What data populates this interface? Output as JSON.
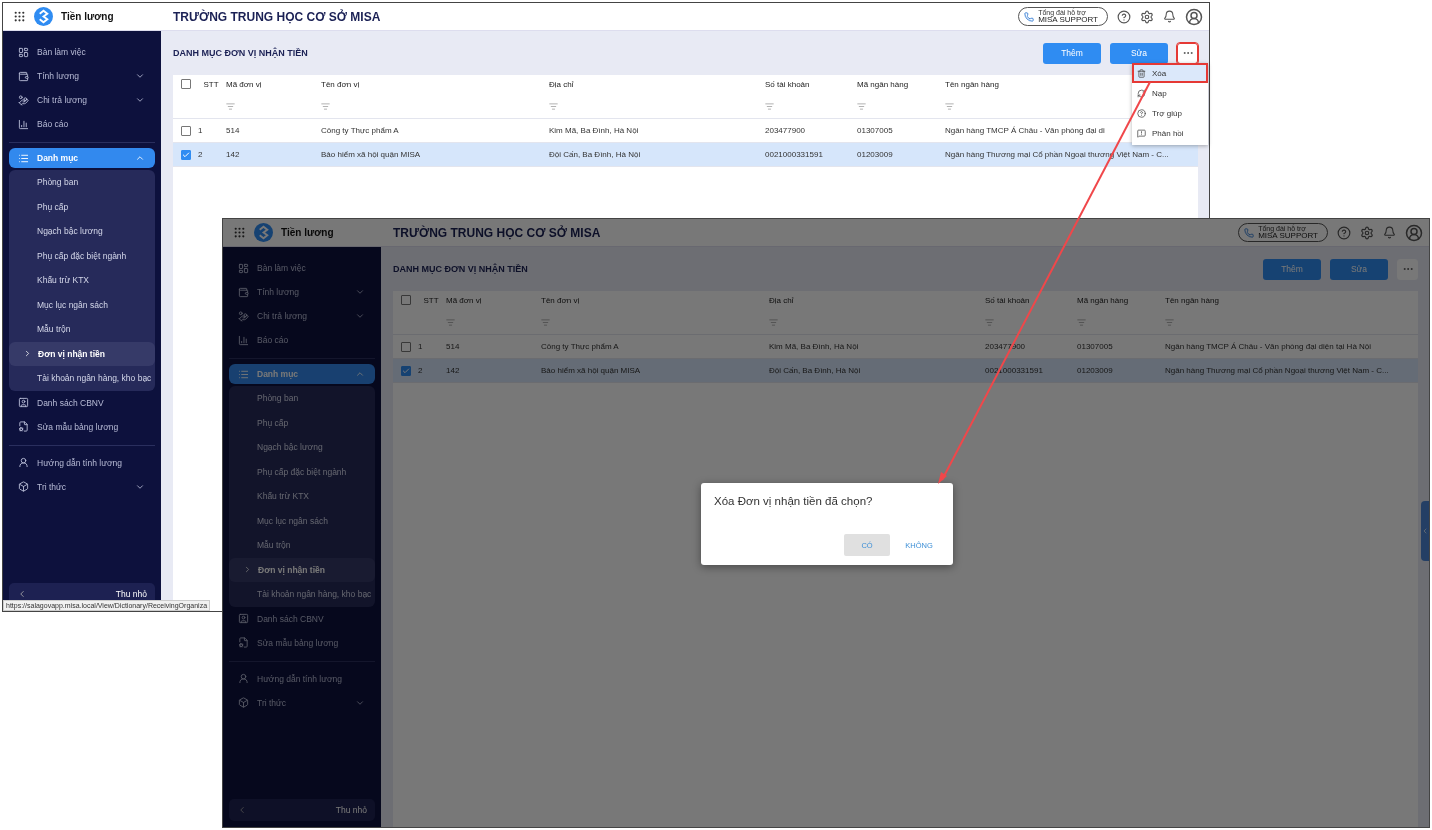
{
  "windows": [
    {
      "app_name": "Tiền lương",
      "school": "TRƯỜNG TRUNG HỌC CƠ SỞ MISA",
      "support": {
        "caption": "Tổng đài hỗ trợ",
        "label": "MISA SUPPORT"
      },
      "sidebar": {
        "groups": [
          [
            {
              "label": "Bàn làm việc",
              "selected": false
            },
            {
              "label": "Tính lương",
              "selected": false,
              "expanded": false
            },
            {
              "label": "Chi trả lương",
              "selected": false,
              "expanded": false
            },
            {
              "label": "Báo cáo",
              "selected": false
            }
          ],
          [
            {
              "label": "Danh mục",
              "selected": true,
              "expanded": true,
              "children": [
                {
                  "label": "Phòng ban",
                  "selected": false
                },
                {
                  "label": "Phụ cấp",
                  "selected": false
                },
                {
                  "label": "Ngạch bậc lương",
                  "selected": false
                },
                {
                  "label": "Phụ cấp đặc biệt ngành",
                  "selected": false
                },
                {
                  "label": "Khấu trừ KTX",
                  "selected": false
                },
                {
                  "label": "Mục lục ngân sách",
                  "selected": false
                },
                {
                  "label": "Mẫu trộn",
                  "selected": false
                },
                {
                  "label": "Đơn vị nhận tiền",
                  "selected": true
                },
                {
                  "label": "Tài khoản ngân hàng, kho bạc",
                  "selected": false
                }
              ]
            },
            {
              "label": "Danh sách CBNV",
              "selected": false
            },
            {
              "label": "Sửa mẫu bảng lương",
              "selected": false
            }
          ],
          [
            {
              "label": "Hướng dẫn tính lương",
              "selected": false
            },
            {
              "label": "Tri thức",
              "selected": false,
              "expanded": false
            }
          ]
        ],
        "collapse_label": "Thu nhỏ"
      },
      "page_title": "DANH MỤC ĐƠN VỊ NHẬN TIỀN",
      "buttons": [
        {
          "label": "Thêm"
        },
        {
          "label": "Sửa"
        }
      ],
      "more_button": {
        "highlighted": true
      },
      "table": {
        "header_checked": false,
        "columns": [
          {
            "label": "STT"
          },
          {
            "label": "Mã đơn vị"
          },
          {
            "label": "Tên đơn vị"
          },
          {
            "label": "Địa chỉ"
          },
          {
            "label": "Số tài khoản"
          },
          {
            "label": "Mã ngân hàng"
          },
          {
            "label": "Tên ngân hàng"
          }
        ],
        "rows": [
          {
            "selected": false,
            "cells": [
              "1",
              "514",
              "Công ty Thực phẩm A",
              "Kim Mã, Ba Đình, Hà Nội",
              "203477900",
              "01307005",
              "Ngân hàng TMCP Á Châu - Văn phòng đại di"
            ]
          },
          {
            "selected": true,
            "cells": [
              "2",
              "142",
              "Bảo hiểm xã hội quận MISA",
              "Đội Cấn, Ba Đình, Hà Nội",
              "0021000331591",
              "01203009",
              "Ngân hàng Thương mại Cổ phần Ngoại thương Việt Nam - C..."
            ]
          }
        ]
      },
      "menu": {
        "items": [
          {
            "label": "Xóa",
            "highlighted": true
          },
          {
            "label": "Nạp",
            "highlighted": false
          },
          {
            "label": "Trợ giúp",
            "highlighted": false
          },
          {
            "label": "Phản hồi",
            "highlighted": false
          }
        ]
      },
      "status_url": "https://salagovapp.misa.local/View/Dictionary/ReceivingOrganiza"
    },
    {
      "app_name": "Tiền lương",
      "school": "TRƯỜNG TRUNG HỌC CƠ SỞ MISA",
      "support": {
        "caption": "Tổng đài hỗ trợ",
        "label": "MISA SUPPORT"
      },
      "sidebar": {
        "groups": [
          [
            {
              "label": "Bàn làm việc",
              "selected": false
            },
            {
              "label": "Tính lương",
              "selected": false,
              "expanded": false
            },
            {
              "label": "Chi trả lương",
              "selected": false,
              "expanded": false
            },
            {
              "label": "Báo cáo",
              "selected": false
            }
          ],
          [
            {
              "label": "Danh mục",
              "selected": true,
              "expanded": true,
              "children": [
                {
                  "label": "Phòng ban",
                  "selected": false
                },
                {
                  "label": "Phụ cấp",
                  "selected": false
                },
                {
                  "label": "Ngạch bậc lương",
                  "selected": false
                },
                {
                  "label": "Phụ cấp đặc biệt ngành",
                  "selected": false
                },
                {
                  "label": "Khấu trừ KTX",
                  "selected": false
                },
                {
                  "label": "Mục lục ngân sách",
                  "selected": false
                },
                {
                  "label": "Mẫu trộn",
                  "selected": false
                },
                {
                  "label": "Đơn vị nhận tiền",
                  "selected": true
                },
                {
                  "label": "Tài khoản ngân hàng, kho bạc",
                  "selected": false
                }
              ]
            },
            {
              "label": "Danh sách CBNV",
              "selected": false
            },
            {
              "label": "Sửa mẫu bảng lương",
              "selected": false
            }
          ],
          [
            {
              "label": "Hướng dẫn tính lương",
              "selected": false
            },
            {
              "label": "Tri thức",
              "selected": false,
              "expanded": false
            }
          ]
        ],
        "collapse_label": "Thu nhỏ"
      },
      "page_title": "DANH MỤC ĐƠN VỊ NHẬN TIỀN",
      "buttons": [
        {
          "label": "Thêm"
        },
        {
          "label": "Sửa"
        }
      ],
      "more_button": {
        "highlighted": false
      },
      "table": {
        "header_checked": false,
        "columns": [
          {
            "label": "STT"
          },
          {
            "label": "Mã đơn vị"
          },
          {
            "label": "Tên đơn vị"
          },
          {
            "label": "Địa chỉ"
          },
          {
            "label": "Số tài khoản"
          },
          {
            "label": "Mã ngân hàng"
          },
          {
            "label": "Tên ngân hàng"
          }
        ],
        "rows": [
          {
            "selected": false,
            "cells": [
              "1",
              "514",
              "Công ty Thực phẩm A",
              "Kim Mã, Ba Đình, Hà Nội",
              "203477900",
              "01307005",
              "Ngân hàng TMCP Á Châu - Văn phòng đại diện tại Hà Nội"
            ]
          },
          {
            "selected": true,
            "cells": [
              "2",
              "142",
              "Bảo hiểm xã hội quận MISA",
              "Đội Cấn, Ba Đình, Hà Nội",
              "0021000331591",
              "01203009",
              "Ngân hàng Thương mại Cổ phần Ngoại thương Việt Nam - C..."
            ]
          }
        ]
      },
      "dialog": {
        "message": "Xóa Đơn vị nhận tiền đã chọn?",
        "buttons": [
          {
            "label": "CÓ",
            "kind": "filled"
          },
          {
            "label": "KHÔNG",
            "kind": "text"
          }
        ]
      }
    }
  ]
}
